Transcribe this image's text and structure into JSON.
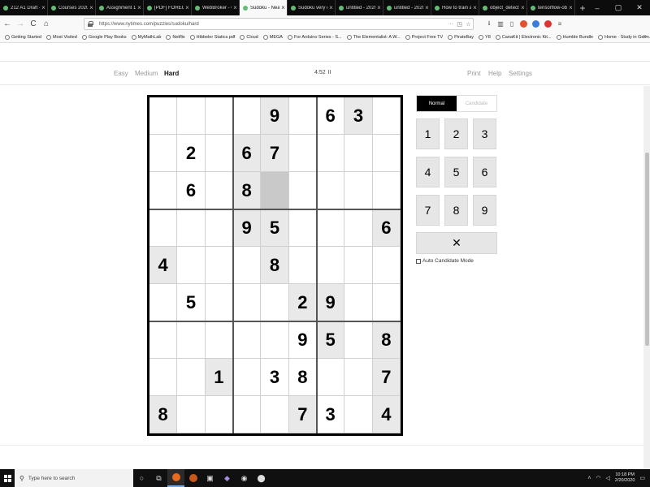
{
  "browser": {
    "tabs": [
      {
        "label": "212 A1 Draft -"
      },
      {
        "label": "Courses 2020/2"
      },
      {
        "label": "Assignment 1 -"
      },
      {
        "label": "[PDF] FORECA"
      },
      {
        "label": "WebBroker - C"
      },
      {
        "label": "Sudoku - Nea",
        "active": true
      },
      {
        "label": "Sudoku very d"
      },
      {
        "label": "untitled - 2020"
      },
      {
        "label": "untitled - 2020"
      },
      {
        "label": "How to train a"
      },
      {
        "label": "object_detectio"
      },
      {
        "label": "tensorflow-obj"
      }
    ],
    "new_tab": "+",
    "window_controls": {
      "minimize": "–",
      "maximize": "▢",
      "close": "✕"
    },
    "url": "https://www.nytimes.com/puzzles/sudoku/hard",
    "nav": {
      "back": "←",
      "forward": "→",
      "reload": "C",
      "home": "⌂"
    },
    "bookmarks": [
      "Getting Started",
      "Most Visited",
      "Google Play Books",
      "MyMathLab",
      "Netflix",
      "Hibbeler Statics.pdf",
      "Cloud",
      "MEGA",
      "For Arduino Series - S...",
      "The Elementalist: A W...",
      "Project Free TV",
      "PirateBay",
      "Y8",
      "CanaKit | Electronic Kit...",
      "Humble Bundle",
      "Home · Study in Germ..."
    ],
    "bookmarks_more": "»"
  },
  "game": {
    "difficulties": [
      {
        "label": "Easy",
        "active": false
      },
      {
        "label": "Medium",
        "active": false
      },
      {
        "label": "Hard",
        "active": true
      }
    ],
    "timer": "4:52",
    "pause": "II",
    "menu": [
      "Print",
      "Help",
      "Settings"
    ]
  },
  "board": {
    "grid": [
      [
        0,
        0,
        0,
        0,
        9,
        0,
        6,
        3,
        0
      ],
      [
        0,
        2,
        0,
        6,
        7,
        0,
        0,
        0,
        0
      ],
      [
        0,
        6,
        0,
        8,
        0,
        0,
        0,
        0,
        0
      ],
      [
        0,
        0,
        0,
        9,
        5,
        0,
        0,
        0,
        6
      ],
      [
        4,
        0,
        0,
        0,
        8,
        0,
        0,
        0,
        0
      ],
      [
        0,
        5,
        0,
        0,
        0,
        2,
        9,
        0,
        0
      ],
      [
        0,
        0,
        0,
        0,
        0,
        9,
        5,
        0,
        8
      ],
      [
        0,
        0,
        1,
        0,
        3,
        8,
        0,
        0,
        7
      ],
      [
        8,
        0,
        0,
        0,
        0,
        7,
        3,
        0,
        4
      ]
    ],
    "given": [
      [
        0,
        0,
        0,
        0,
        1,
        0,
        0,
        1,
        0
      ],
      [
        0,
        0,
        0,
        1,
        1,
        0,
        0,
        0,
        0
      ],
      [
        0,
        0,
        0,
        1,
        0,
        0,
        0,
        0,
        0
      ],
      [
        0,
        0,
        0,
        1,
        1,
        0,
        0,
        0,
        1
      ],
      [
        1,
        0,
        0,
        0,
        1,
        0,
        0,
        0,
        0
      ],
      [
        0,
        0,
        0,
        0,
        0,
        1,
        1,
        0,
        0
      ],
      [
        0,
        0,
        0,
        0,
        0,
        0,
        1,
        0,
        1
      ],
      [
        0,
        0,
        1,
        0,
        0,
        0,
        0,
        0,
        1
      ],
      [
        1,
        0,
        0,
        0,
        0,
        1,
        0,
        0,
        1
      ]
    ],
    "selected": [
      2,
      4
    ]
  },
  "controls": {
    "modes": [
      {
        "label": "Normal",
        "active": true
      },
      {
        "label": "Candidate",
        "active": false
      }
    ],
    "numbers": [
      "1",
      "2",
      "3",
      "4",
      "5",
      "6",
      "7",
      "8",
      "9"
    ],
    "erase": "✕",
    "auto_candidate": "Auto Candidate Mode"
  },
  "taskbar": {
    "search_placeholder": "Type here to search",
    "clock_time": "10:18 PM",
    "clock_date": "2/20/2020"
  }
}
